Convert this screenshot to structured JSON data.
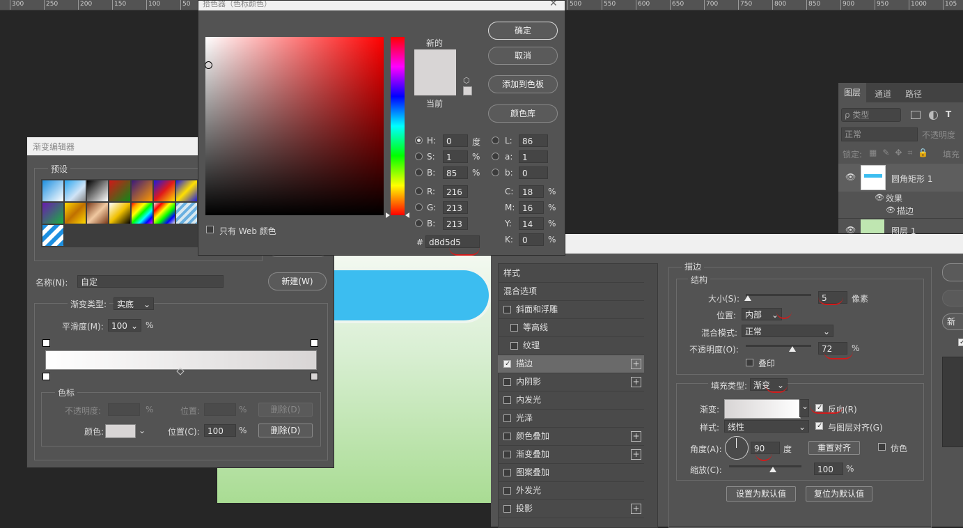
{
  "ruler": {
    "left_labels": [
      "300",
      "250",
      "200",
      "150",
      "100",
      "50"
    ],
    "right_labels": [
      "500",
      "550",
      "600",
      "650",
      "700",
      "750",
      "800",
      "850",
      "900",
      "950",
      "1000",
      "105"
    ]
  },
  "picker": {
    "title": "拾色器（色标颜色）",
    "new_label": "新的",
    "current_label": "当前",
    "ok": "确定",
    "cancel": "取消",
    "add_swatch": "添加到色板",
    "color_lib": "颜色库",
    "h_label": "H:",
    "h": "0",
    "h_unit": "度",
    "s_label": "S:",
    "s": "1",
    "s_unit": "%",
    "b_label": "B:",
    "b": "85",
    "b_unit": "%",
    "r_label": "R:",
    "r": "216",
    "g_label": "G:",
    "g": "213",
    "bl_label": "B:",
    "bl": "213",
    "l_label": "L:",
    "l": "86",
    "a_label": "a:",
    "a": "1",
    "lb_label": "b:",
    "lb": "0",
    "c_label": "C:",
    "c": "18",
    "m_label": "M:",
    "m": "16",
    "y_label": "Y:",
    "y": "14",
    "k_label": "K:",
    "k": "0",
    "pct": "%",
    "hash": "#",
    "hex": "d8d5d5",
    "web_only": "只有 Web 颜色",
    "colors": {
      "new": "#d8d5d5",
      "current": "#d8d5d5"
    }
  },
  "gradient": {
    "title": "渐变编辑器",
    "presets": "预设",
    "name_label": "名称(N):",
    "name": "自定",
    "new_btn": "新建(W)",
    "type_label": "渐变类型:",
    "type": "实底",
    "smooth_label": "平滑度(M):",
    "smooth": "100",
    "pct": "%",
    "stops_label": "色标",
    "opacity_label": "不透明度:",
    "pos_label": "位置:",
    "delete": "删除(D)",
    "color_label": "颜色:",
    "pos_c_label": "位置(C):",
    "pos_c": "100",
    "delete2": "删除(D)"
  },
  "layers": {
    "tabs": [
      "图层",
      "通道",
      "路径"
    ],
    "filter": "ρ 类型",
    "blend": "正常",
    "opacity": "不透明度",
    "lock": "锁定:",
    "fill": "填充",
    "layer1": "圆角矩形 1",
    "effects": "效果",
    "stroke": "描边",
    "layer2": "图层 1"
  },
  "style": {
    "items": [
      "样式",
      "混合选项",
      "斜面和浮雕",
      "等高线",
      "纹理",
      "描边",
      "内阴影",
      "内发光",
      "光泽",
      "颜色叠加",
      "渐变叠加",
      "图案叠加",
      "外发光",
      "投影"
    ],
    "section": "描边",
    "structure": "结构",
    "size_label": "大小(S):",
    "size": "5",
    "size_unit": "像素",
    "position_label": "位置:",
    "position": "内部",
    "blend_label": "混合模式:",
    "blend": "正常",
    "opacity_label": "不透明度(O):",
    "opacity": "72",
    "pct": "%",
    "overprint": "叠印",
    "fill_type_label": "填充类型:",
    "fill_type": "渐变",
    "gradient_label": "渐变:",
    "reverse": "反向(R)",
    "style_label": "样式:",
    "style_val": "线性",
    "align": "与图层对齐(G)",
    "angle_label": "角度(A):",
    "angle": "90",
    "angle_unit": "度",
    "reset_align": "重置对齐",
    "dither": "仿色",
    "scale_label": "缩放(C):",
    "scale": "100",
    "set_default": "设置为默认值",
    "reset_default": "复位为默认值",
    "new_partial": "新"
  }
}
